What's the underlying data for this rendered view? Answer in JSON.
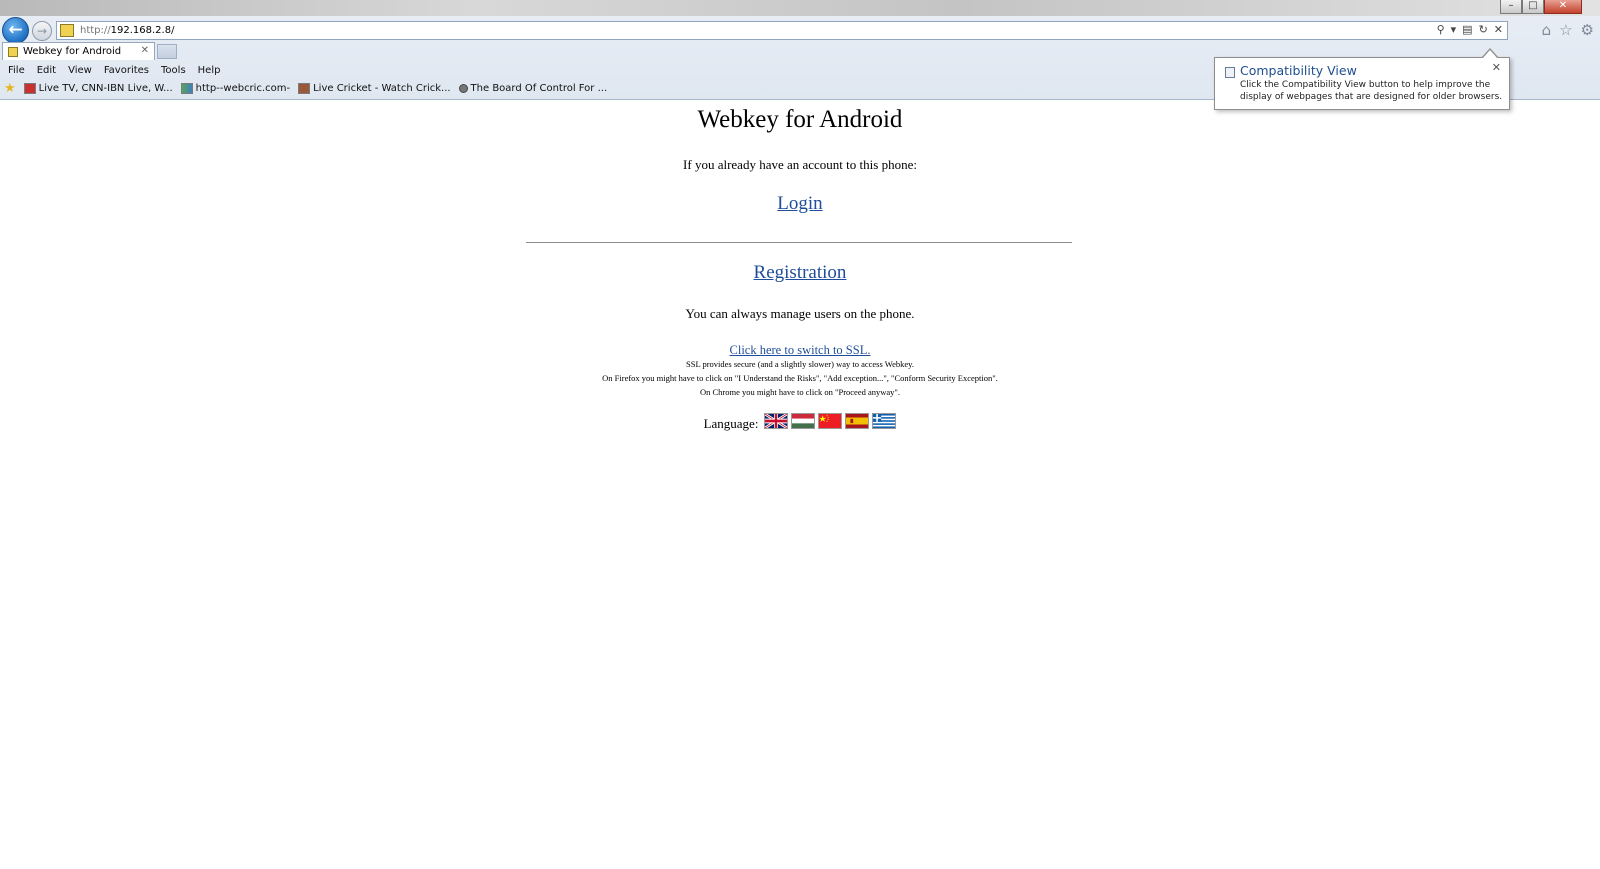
{
  "browser": {
    "titlebar_faded": "",
    "address_url_proto": "http://",
    "address_url_host": "192.168.2.8/",
    "tab_title": "Webkey for Android",
    "menu": [
      "File",
      "Edit",
      "View",
      "Favorites",
      "Tools",
      "Help"
    ],
    "favorites": [
      {
        "label": "Live TV, CNN-IBN Live, W...",
        "icon": "tv-icon"
      },
      {
        "label": "http--webcric.com-",
        "icon": "web-icon"
      },
      {
        "label": "Live Cricket - Watch Crick...",
        "icon": "cricket-icon"
      },
      {
        "label": "The Board Of Control For ...",
        "icon": "bcci-icon"
      }
    ],
    "compat_popup": {
      "title": "Compatibility View",
      "body": "Click the Compatibility View button to help improve the display of webpages that are designed for older browsers."
    }
  },
  "page": {
    "title": "Webkey for Android",
    "intro": "If you already have an account to this phone:",
    "login_link": "Login",
    "registration_link": "Registration",
    "manage_text": "You can always manage users on the phone.",
    "ssl_link": "Click here to switch to SSL.",
    "ssl_notes": [
      "SSL provides secure (and a slightly slower) way to access Webkey.",
      "On Firefox you might have to click on \"I Understand the Risks\", \"Add exception...\", \"Conform Security Exception\".",
      "On Chrome you might have to click on \"Proceed anyway\"."
    ],
    "language_label": "Language:",
    "languages": [
      "uk-flag",
      "hungary-flag",
      "china-flag",
      "spain-flag",
      "greece-flag"
    ]
  },
  "colors": {
    "link": "#1f4d99",
    "chrome_bg": "#e4ebf4",
    "accent_blue": "#1d6fc4"
  }
}
